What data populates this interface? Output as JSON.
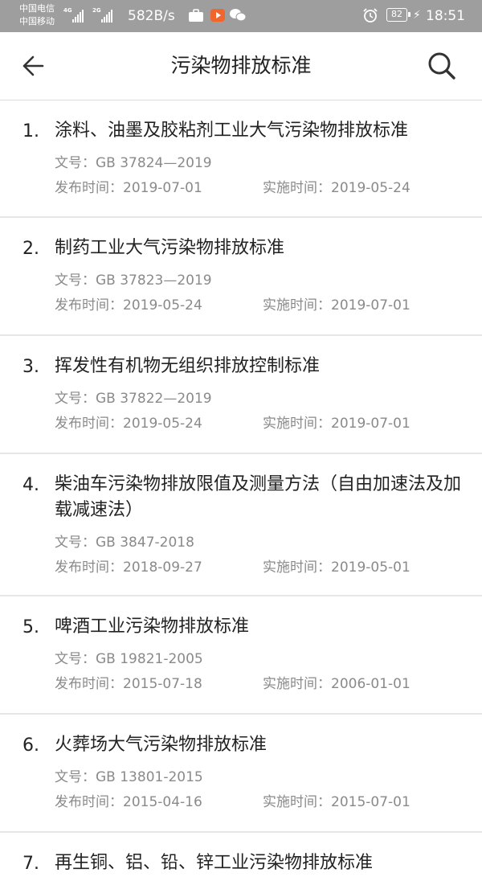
{
  "status_bar": {
    "carrier_1": "中国电信",
    "carrier_2": "中国移动",
    "net_1": "4G",
    "net_2": "2G",
    "speed": "582B/s",
    "battery": "82",
    "time": "18:51",
    "icons": [
      "signal-icon",
      "briefcase-icon",
      "video-app-icon",
      "wechat-icon",
      "alarm-icon",
      "battery-icon",
      "charging-icon"
    ]
  },
  "header": {
    "title": "污染物排放标准",
    "back_icon": "back-arrow-icon",
    "search_icon": "search-icon"
  },
  "labels": {
    "doc_no": "文号：",
    "published": "发布时间：",
    "implemented": "实施时间："
  },
  "standards": [
    {
      "num": "1.",
      "title": "涂料、油墨及胶粘剂工业大气污染物排放标准",
      "doc_no": "GB 37824—2019",
      "published": "2019-07-01",
      "implemented": "2019-05-24"
    },
    {
      "num": "2.",
      "title": "制药工业大气污染物排放标准",
      "doc_no": "GB 37823—2019",
      "published": "2019-05-24",
      "implemented": "2019-07-01"
    },
    {
      "num": "3.",
      "title": "挥发性有机物无组织排放控制标准",
      "doc_no": "GB 37822—2019",
      "published": "2019-05-24",
      "implemented": "2019-07-01"
    },
    {
      "num": "4.",
      "title": "柴油车污染物排放限值及测量方法（自由加速法及加载减速法）",
      "doc_no": "GB 3847-2018",
      "published": "2018-09-27",
      "implemented": "2019-05-01"
    },
    {
      "num": "5.",
      "title": "啤酒工业污染物排放标准",
      "doc_no": "GB 19821-2005",
      "published": "2015-07-18",
      "implemented": "2006-01-01"
    },
    {
      "num": "6.",
      "title": "火葬场大气污染物排放标准",
      "doc_no": "GB 13801-2015",
      "published": "2015-04-16",
      "implemented": "2015-07-01"
    },
    {
      "num": "7.",
      "title": "再生铜、铝、铅、锌工业污染物排放标准",
      "doc_no": "",
      "published": "",
      "implemented": ""
    }
  ]
}
